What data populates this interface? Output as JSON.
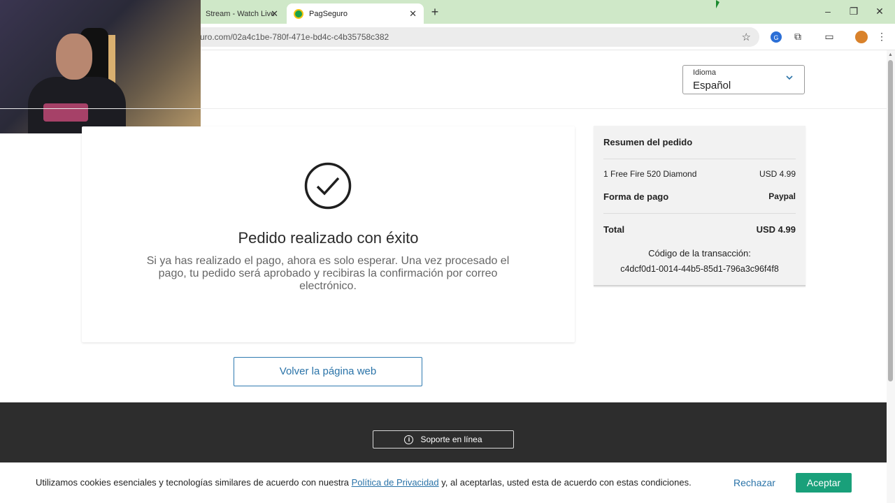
{
  "browser": {
    "tabs": [
      {
        "label": "Stream - Watch Live",
        "active": false
      },
      {
        "label": "PagSeguro",
        "active": true
      }
    ],
    "url": "uro.com/02a4c1be-780f-471e-bd4c-c4b35758c382",
    "colors": {
      "tabbar": "#cfe8c8"
    }
  },
  "header": {
    "language_label": "Idioma",
    "language_value": "Español"
  },
  "main": {
    "title": "Pedido realizado con éxito",
    "message": "Si ya has realizado el pago, ahora es solo esperar. Una vez procesado el pago, tu pedido será aprobado y recibiras la confirmación por correo electrónico.",
    "back_button": "Volver la página web"
  },
  "summary": {
    "title": "Resumen del pedido",
    "item_label": "1 Free Fire 520 Diamond",
    "item_price": "USD 4.99",
    "payment_label": "Forma de pago",
    "payment_value": "Paypal",
    "total_label": "Total",
    "total_value": "USD 4.99",
    "transaction_label": "Código de la transacción:",
    "transaction_id": "c4dcf0d1-0014-44b5-85d1-796a3c96f4f8"
  },
  "footer": {
    "support_button": "Soporte en línea"
  },
  "cookie_banner": {
    "text_before": "Utilizamos cookies esenciales y tecnologías similares de acuerdo con nuestra ",
    "privacy_link": "Política de Privacidad",
    "text_after": " y, al aceptarlas, usted esta de acuerdo con estas condiciones.",
    "reject": "Rechazar",
    "accept": "Aceptar",
    "accept_color": "#19a07a"
  }
}
